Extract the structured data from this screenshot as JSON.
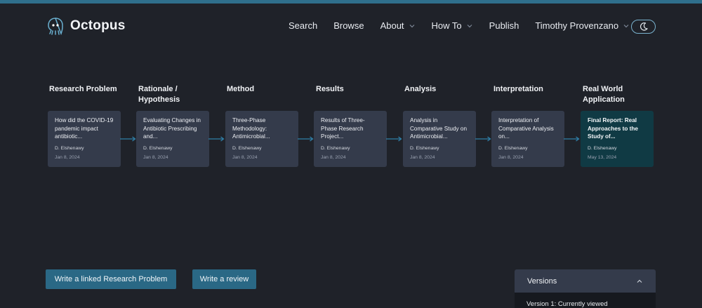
{
  "header": {
    "brand": "Octopus",
    "nav": [
      {
        "label": "Search",
        "dropdown": false
      },
      {
        "label": "Browse",
        "dropdown": false
      },
      {
        "label": "About",
        "dropdown": true
      },
      {
        "label": "How To",
        "dropdown": true
      },
      {
        "label": "Publish",
        "dropdown": false
      },
      {
        "label": "Timothy Provenzano",
        "dropdown": true
      }
    ],
    "theme_toggle_icon": "moon-icon"
  },
  "stages": [
    {
      "title": "Research Problem",
      "card_title": "How did the COVID-19 pandemic impact antibiotic...",
      "author": "D. Elshenawy",
      "date": "Jan 8, 2024",
      "current": false
    },
    {
      "title": "Rationale / Hypothesis",
      "card_title": "Evaluating Changes in Antibiotic Prescribing and...",
      "author": "D. Elshenawy",
      "date": "Jan 8, 2024",
      "current": false
    },
    {
      "title": "Method",
      "card_title": "Three-Phase Methodology: Antimicrobial...",
      "author": "D. Elshenawy",
      "date": "Jan 8, 2024",
      "current": false
    },
    {
      "title": "Results",
      "card_title": "Results of Three-Phase Research Project...",
      "author": "D. Elshenawy",
      "date": "Jan 8, 2024",
      "current": false
    },
    {
      "title": "Analysis",
      "card_title": "Analysis in Comparative Study on Antimicrobial...",
      "author": "D. Elshenawy",
      "date": "Jan 8, 2024",
      "current": false
    },
    {
      "title": "Interpretation",
      "card_title": "Interpretation of Comparative Analysis on...",
      "author": "D. Elshenawy",
      "date": "Jan 8, 2024",
      "current": false
    },
    {
      "title": "Real World Application",
      "card_title": "Final Report: Real Approaches to the Study of...",
      "author": "D. Elshenawy",
      "date": "May 13, 2024",
      "current": true
    }
  ],
  "actions": {
    "linked_problem": "Write a linked Research Problem",
    "review": "Write a review"
  },
  "versions": {
    "title": "Versions",
    "current_label": "Version 1: Currently viewed"
  },
  "colors": {
    "background": "#1f2229",
    "card": "#343b4b",
    "current_card": "#103a44",
    "accent": "#2a6885",
    "arrow": "#2f7fa8"
  }
}
